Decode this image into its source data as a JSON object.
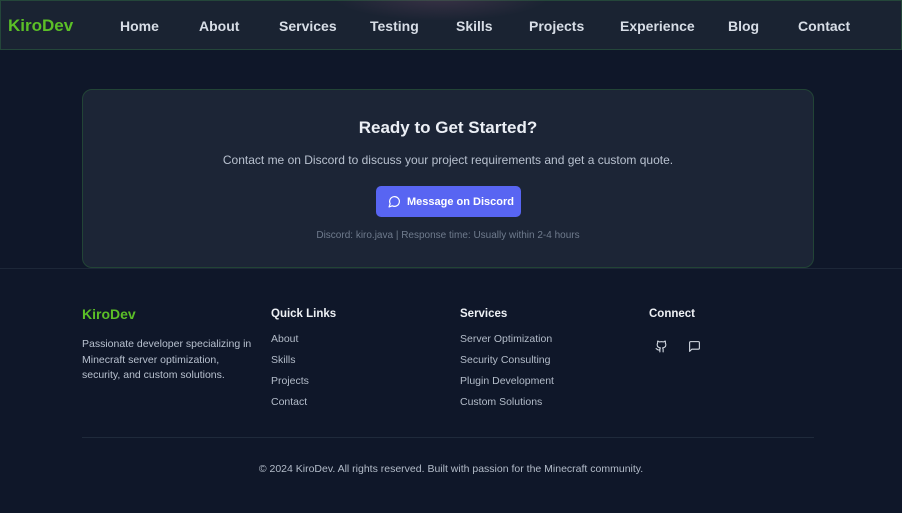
{
  "nav": {
    "brand": "KiroDev",
    "links": [
      "Home",
      "About",
      "Services",
      "Testing",
      "Skills",
      "Projects",
      "Experience",
      "Blog",
      "Contact"
    ]
  },
  "cta": {
    "title": "Ready to Get Started?",
    "text": "Contact me on Discord to discuss your project requirements and get a custom quote.",
    "button_label": "Message on Discord",
    "button_icon": "message-circle-icon",
    "meta": "Discord: kiro.java | Response time: Usually within 2-4 hours"
  },
  "footer": {
    "brand": "KiroDev",
    "description": "Passionate developer specializing in Minecraft server optimization, security, and custom solutions.",
    "quick_links": {
      "heading": "Quick Links",
      "items": [
        "About",
        "Skills",
        "Projects",
        "Contact"
      ]
    },
    "services": {
      "heading": "Services",
      "items": [
        "Server Optimization",
        "Security Consulting",
        "Plugin Development",
        "Custom Solutions"
      ]
    },
    "connect": {
      "heading": "Connect",
      "icons": [
        "github-icon",
        "message-square-icon"
      ]
    },
    "copyright": "© 2024 KiroDev. All rights reserved. Built with passion for the Minecraft community."
  },
  "colors": {
    "background": "#0f1729",
    "nav_background": "#1a2332",
    "brand_green": "#5bbf27",
    "discord_blurple": "#5865f2",
    "card_background": "#1c2536"
  }
}
